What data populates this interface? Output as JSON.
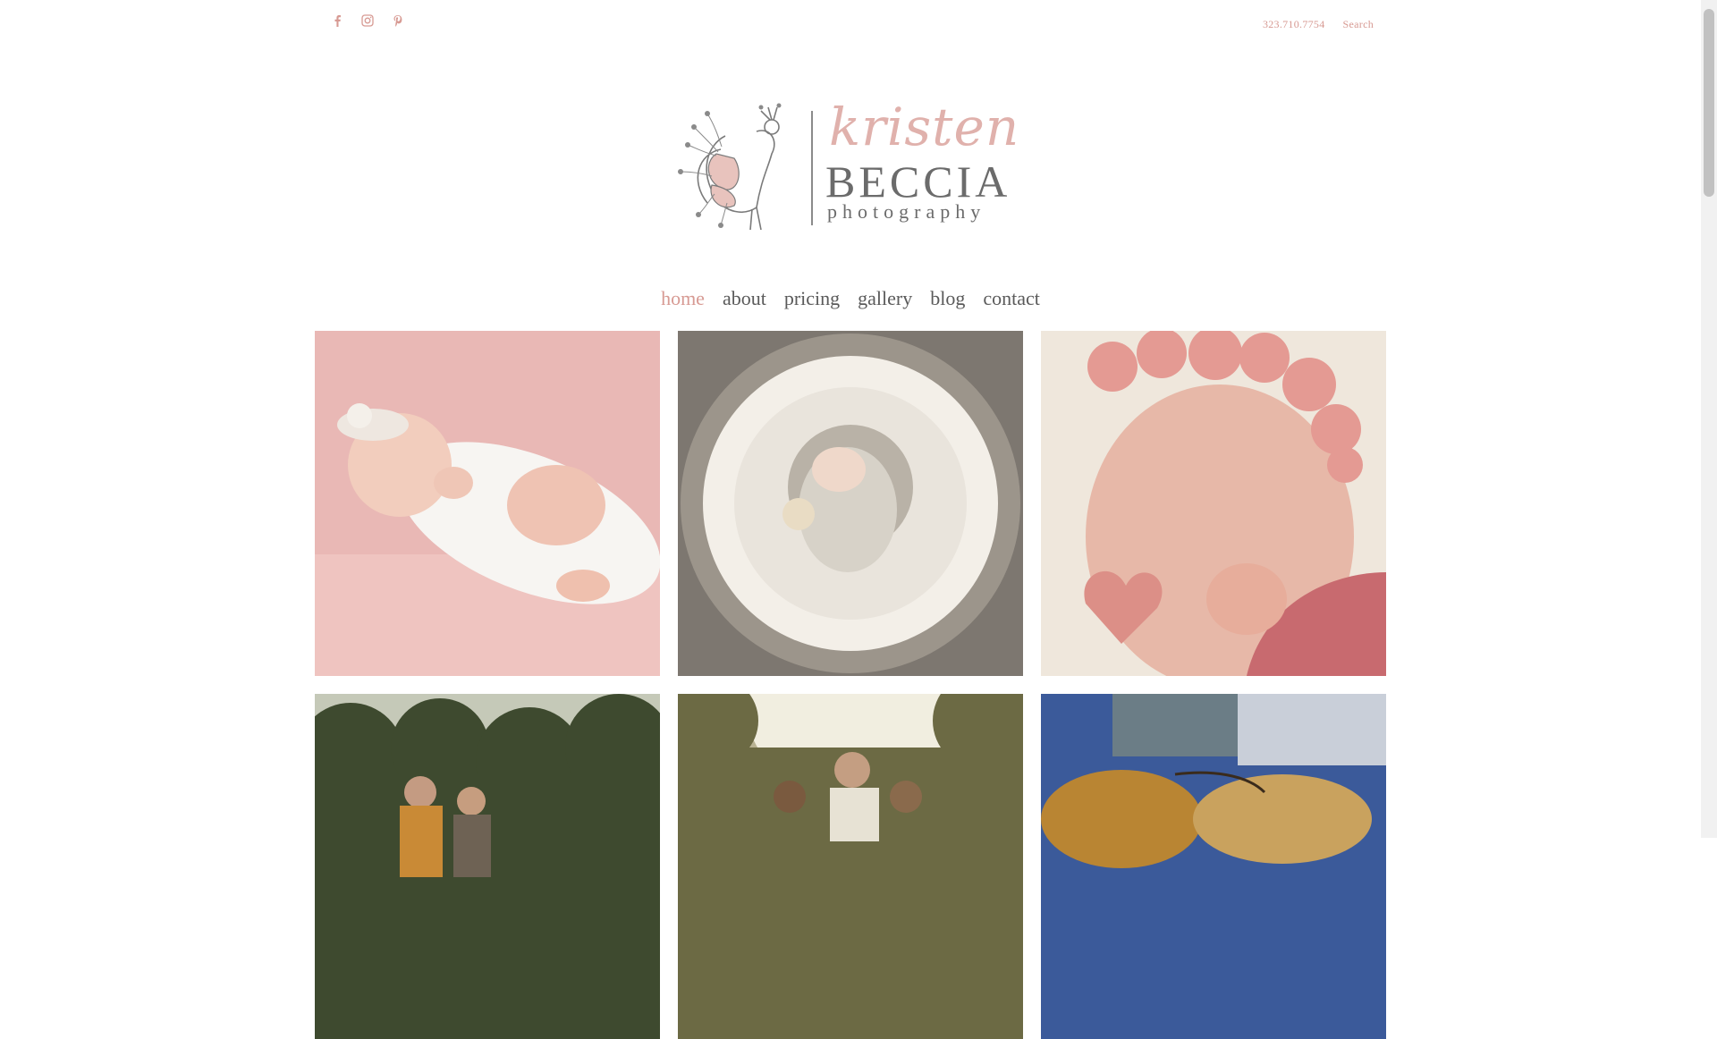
{
  "header": {
    "social": [
      {
        "icon": "facebook-icon",
        "glyph": "f"
      },
      {
        "icon": "instagram-icon",
        "glyph": "◻"
      },
      {
        "icon": "pinterest-icon",
        "glyph": "p"
      }
    ],
    "phone": "323.710.7754",
    "search_label": "Search"
  },
  "logo": {
    "script": "kristen",
    "name": "BECCIA",
    "sub": "photography"
  },
  "nav": {
    "items": [
      {
        "label": "home",
        "active": true
      },
      {
        "label": "about"
      },
      {
        "label": "pricing"
      },
      {
        "label": "gallery"
      },
      {
        "label": "blog"
      },
      {
        "label": "contact"
      }
    ]
  },
  "colors": {
    "accent": "#d79a93",
    "text": "#5a5a5a"
  }
}
